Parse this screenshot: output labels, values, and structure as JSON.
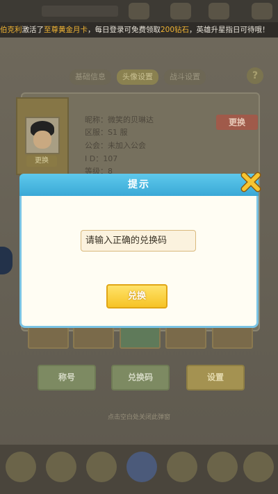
{
  "marquee": {
    "player": "伯克利",
    "text1": "激活了",
    "item": "至尊黄金月卡",
    "text2": "，每日登录可免费领取",
    "reward": "200钻石",
    "text3": "，英雄升星指日可待哦！"
  },
  "header": {
    "nickname": "微笑的贝琳达"
  },
  "tabs": [
    {
      "label": "基础信息"
    },
    {
      "label": "头像设置"
    },
    {
      "label": "战斗设置"
    }
  ],
  "profile": {
    "avatar_change_label": "更换",
    "nickname_label": "昵称：微笑的贝琳达",
    "server_label": "区服：S1 服",
    "guild_label": "公会：未加入公会",
    "id_label": "I  D：107",
    "level_label": "等级：8",
    "change_btn_label": "更换"
  },
  "bottom_buttons": [
    {
      "label": "称号"
    },
    {
      "label": "兑换码"
    },
    {
      "label": "设置"
    }
  ],
  "hint": "点击空白处关闭此弹窗",
  "modal": {
    "title": "提示",
    "input_value": "请输入正确的兑换码",
    "exchange_label": "兑换"
  },
  "colors": {
    "modal_header": "#3aa8d6",
    "exchange_button": "#f6c326",
    "highlight_text": "#f0b434"
  }
}
